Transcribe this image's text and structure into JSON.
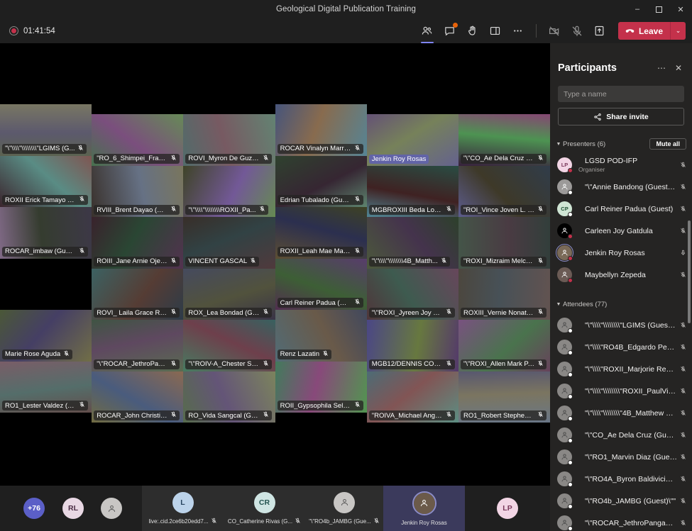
{
  "window": {
    "title": "Geological Digital Publication Training",
    "minimize_label": "–",
    "maximize_label": "❐",
    "close_label": "✕"
  },
  "toolbar": {
    "recording_time": "01:41:54",
    "buttons": [
      {
        "name": "people-icon",
        "label": "People",
        "active": true,
        "badge": false
      },
      {
        "name": "chat-icon",
        "label": "Chat",
        "active": false,
        "badge": true
      },
      {
        "name": "react-icon",
        "label": "React",
        "active": false,
        "badge": false
      },
      {
        "name": "breakout-rooms-icon",
        "label": "Rooms",
        "active": false,
        "badge": false
      },
      {
        "name": "more-options-icon",
        "label": "More actions",
        "active": false,
        "badge": false
      }
    ],
    "camera_label": "Camera off",
    "mic_label": "Mic off",
    "share_label": "Share content",
    "leave_label": "Leave",
    "leave_caret": "⌄",
    "leave_color": "#c4314b"
  },
  "stage": {
    "tiles": [
      {
        "name": "\"\\\"\\\\\\\\\"\\\\\\\\\\\\\\\\\"LGIMS (G...",
        "muted": true,
        "speaking": false,
        "col": 0,
        "row": 0
      },
      {
        "name": "\"RO_6_Shimpei_Francis...",
        "muted": true,
        "speaking": false,
        "col": 1,
        "row": 0
      },
      {
        "name": "ROVI_Myron De Guzm...",
        "muted": true,
        "speaking": false,
        "col": 2,
        "row": 0
      },
      {
        "name": "ROCAR Vinalyn Marrero",
        "muted": true,
        "speaking": false,
        "col": 3,
        "row": 0
      },
      {
        "name": "Jenkin Roy Rosas",
        "muted": false,
        "speaking": true,
        "col": 4,
        "row": 0
      },
      {
        "name": "\"\\\"CO_Ae Dela Cruz (G...",
        "muted": true,
        "speaking": false,
        "col": 5,
        "row": 0
      },
      {
        "name": "ROXII Erick Tamayo (GI...",
        "muted": true,
        "speaking": false,
        "col": 0,
        "row": 1
      },
      {
        "name": "RVIII_Brent Dayao (Gue...",
        "muted": true,
        "speaking": false,
        "col": 1,
        "row": 1
      },
      {
        "name": "\"\\\"\\\\\\\\\"\\\\\\\\\\\\\\\\ROXII_Pa...",
        "muted": true,
        "speaking": false,
        "col": 2,
        "row": 1
      },
      {
        "name": "Edrian Tubalado (Guest)",
        "muted": true,
        "speaking": false,
        "col": 3,
        "row": 1
      },
      {
        "name": "MGBROXIII Beda Louie...",
        "muted": true,
        "speaking": false,
        "col": 4,
        "row": 1
      },
      {
        "name": "\"ROI_Vince Joven L. Na...",
        "muted": true,
        "speaking": false,
        "col": 5,
        "row": 1
      },
      {
        "name": "ROCAR_imbaw (Guest)",
        "muted": true,
        "speaking": false,
        "col": 0,
        "row": 2
      },
      {
        "name": "ROIII_Jane Arnie Ojena...",
        "muted": true,
        "speaking": false,
        "col": 1,
        "row": 2
      },
      {
        "name": "VINCENT GASCAL",
        "muted": true,
        "speaking": false,
        "col": 2,
        "row": 2
      },
      {
        "name": "ROXII_Leah Mae Marie...",
        "muted": true,
        "speaking": false,
        "col": 3,
        "row": 2
      },
      {
        "name": "\"\\\"\\\\\\\\\"\\\\\\\\\\\\\\\\4B_Matth...",
        "muted": true,
        "speaking": false,
        "col": 4,
        "row": 2
      },
      {
        "name": "\"ROXI_Mizraim Melcho...",
        "muted": true,
        "speaking": false,
        "col": 5,
        "row": 2
      },
      {
        "name": "ROVI_ Laila Grace Roxa...",
        "muted": true,
        "speaking": false,
        "col": 1,
        "row": 3
      },
      {
        "name": "ROX_Lea Bondad (Guest)",
        "muted": true,
        "speaking": false,
        "col": 2,
        "row": 3
      },
      {
        "name": "Carl Reiner Padua (Gue...",
        "muted": true,
        "speaking": false,
        "col": 3,
        "row": 3
      },
      {
        "name": "\"\\\"ROXI_Jyreen Joy Pe...",
        "muted": true,
        "speaking": false,
        "col": 4,
        "row": 3
      },
      {
        "name": "ROXIII_Vernie Nonato (...",
        "muted": true,
        "speaking": false,
        "col": 5,
        "row": 3
      },
      {
        "name": "Marie Rose Aguda",
        "muted": true,
        "speaking": false,
        "col": 0,
        "row": 4
      },
      {
        "name": "\"\\\"ROCAR_JethroPang...",
        "muted": true,
        "speaking": false,
        "col": 1,
        "row": 4
      },
      {
        "name": "\"\\\"ROIV-A_Chester Sta...",
        "muted": true,
        "speaking": false,
        "col": 2,
        "row": 4
      },
      {
        "name": "Renz Lazatin",
        "muted": true,
        "speaking": false,
        "col": 3,
        "row": 4
      },
      {
        "name": "MGB12/DENNIS CORTE...",
        "muted": true,
        "speaking": false,
        "col": 4,
        "row": 4
      },
      {
        "name": "\"\\\"ROXI_Allen Mark P. ...",
        "muted": true,
        "speaking": false,
        "col": 5,
        "row": 4
      },
      {
        "name": "RO1_Lester Valdez (Gu...",
        "muted": true,
        "speaking": false,
        "col": 0,
        "row": 5
      },
      {
        "name": "ROCAR_John Christian ...",
        "muted": true,
        "speaking": false,
        "col": 1,
        "row": 5
      },
      {
        "name": "RO_Vida Sangcal (Guest)",
        "muted": true,
        "speaking": false,
        "col": 2,
        "row": 5
      },
      {
        "name": "ROII_Gypsophila Selva...",
        "muted": true,
        "speaking": false,
        "col": 3,
        "row": 5
      },
      {
        "name": "\"ROIVA_Michael Angel...",
        "muted": true,
        "speaking": false,
        "col": 4,
        "row": 5
      },
      {
        "name": "RO1_Robert Stephen L...",
        "muted": true,
        "speaking": false,
        "col": 5,
        "row": 5
      }
    ]
  },
  "tray": {
    "overflow_count": "+76",
    "cells": [
      {
        "kind": "count",
        "initials": "+76",
        "label": "",
        "muted": false,
        "color": "#5b5fc7",
        "text_color": "#ffffff"
      },
      {
        "kind": "avatar",
        "initials": "RL",
        "label": "",
        "muted": false,
        "color": "#e9d8e4",
        "text_color": "#4a2c44"
      },
      {
        "kind": "avatar",
        "initials": "",
        "label": "",
        "muted": false,
        "color": "#c8c6c4",
        "text_color": "#3a3a3a"
      },
      {
        "kind": "video",
        "initials": "L",
        "label": "live:.cid.2ce6b20edd7...",
        "muted": true,
        "color": "#bcd3ea",
        "text_color": "#28445f"
      },
      {
        "kind": "video",
        "initials": "CR",
        "label": "CO_Catherine Rivas (G...",
        "muted": true,
        "color": "#cfe5e3",
        "text_color": "#23534f"
      },
      {
        "kind": "video",
        "initials": "",
        "label": "\"\\\"RO4b_JAMBG (Gue...",
        "muted": true,
        "color": "#c8c6c4",
        "text_color": "#3a3a3a"
      },
      {
        "kind": "active",
        "initials": "",
        "label": "Jenkin Roy Rosas",
        "muted": false,
        "color": "#6b5a4a",
        "text_color": "#ffffff"
      },
      {
        "kind": "avatar",
        "initials": "LP",
        "label": "",
        "muted": false,
        "color": "#f2d5e5",
        "text_color": "#7a3a5c"
      }
    ]
  },
  "panel": {
    "title": "Participants",
    "more_label": "⋯",
    "close_label": "✕",
    "search_placeholder": "Type a name",
    "search_value": "",
    "share_invite_label": "Share invite",
    "presenters": {
      "header": "Presenters (6)",
      "mute_all_label": "Mute all",
      "items": [
        {
          "name": "LGSD POD-IFP",
          "sub": "Organiser",
          "initials": "LP",
          "color": "#f2d5e5",
          "text_color": "#7a3a5c",
          "presence": "#c4314b",
          "mic": "muted",
          "speaking": false
        },
        {
          "name": "\"\\\"Annie Bandong (Guest)\\\"\"",
          "sub": "",
          "initials": "",
          "color": "#9c9a99",
          "text_color": "#ffffff",
          "presence": "#ffffff",
          "mic": "muted",
          "speaking": false
        },
        {
          "name": "Carl Reiner Padua (Guest)",
          "sub": "",
          "initials": "CP",
          "color": "#cfe5d4",
          "text_color": "#1f5134",
          "presence": "#ffffff",
          "mic": "muted",
          "speaking": false
        },
        {
          "name": "Carleen Joy Gatdula",
          "sub": "",
          "initials": "",
          "color": "#000000",
          "text_color": "#ffffff",
          "presence": "#c4314b",
          "mic": "muted",
          "speaking": false
        },
        {
          "name": "Jenkin Roy Rosas",
          "sub": "",
          "initials": "",
          "color": "#7a6a58",
          "text_color": "#ffffff",
          "presence": "#c4314b",
          "mic": "unmuted",
          "speaking": true
        },
        {
          "name": "Maybellyn Zepeda",
          "sub": "",
          "initials": "",
          "color": "#6b5b55",
          "text_color": "#ffffff",
          "presence": "#c4314b",
          "mic": "muted",
          "speaking": false
        }
      ]
    },
    "attendees": {
      "header": "Attendees (77)",
      "items": [
        {
          "name": "\"\\\"\\\\\\\\\"\\\\\\\\\\\\\\\\\"LGIMS (Guest)\\\\\\\\\\\\...",
          "mic": "muted"
        },
        {
          "name": "\"\\\"\\\\\\\\\"RO4B_Edgardo Pena Jr (...",
          "mic": "muted"
        },
        {
          "name": "\"\\\"\\\\\\\\\"ROXII_Marjorie Rebuyo...",
          "mic": "muted"
        },
        {
          "name": "\"\\\"\\\\\\\\\"\\\\\\\\\\\\\\\\\"ROXII_PaulVince...",
          "mic": "muted"
        },
        {
          "name": "\"\\\"\\\\\\\\\"\\\\\\\\\\\\\\\\\"4B_Matthew Gar...",
          "mic": "muted"
        },
        {
          "name": "\"\\\"CO_Ae Dela Cruz (Guest)\\\"\"",
          "mic": "muted"
        },
        {
          "name": "\"\\\"RO1_Marvin Diaz (Guest)\\\"\"",
          "mic": "muted"
        },
        {
          "name": "\"\\\"RO4A_Byron Baldivicio (Gu...",
          "mic": "muted"
        },
        {
          "name": "\"\\\"RO4b_JAMBG (Guest)\\\"\"",
          "mic": "muted"
        },
        {
          "name": "\"\\\"ROCAR_JethroPanganiban ...",
          "mic": "muted"
        }
      ]
    }
  }
}
